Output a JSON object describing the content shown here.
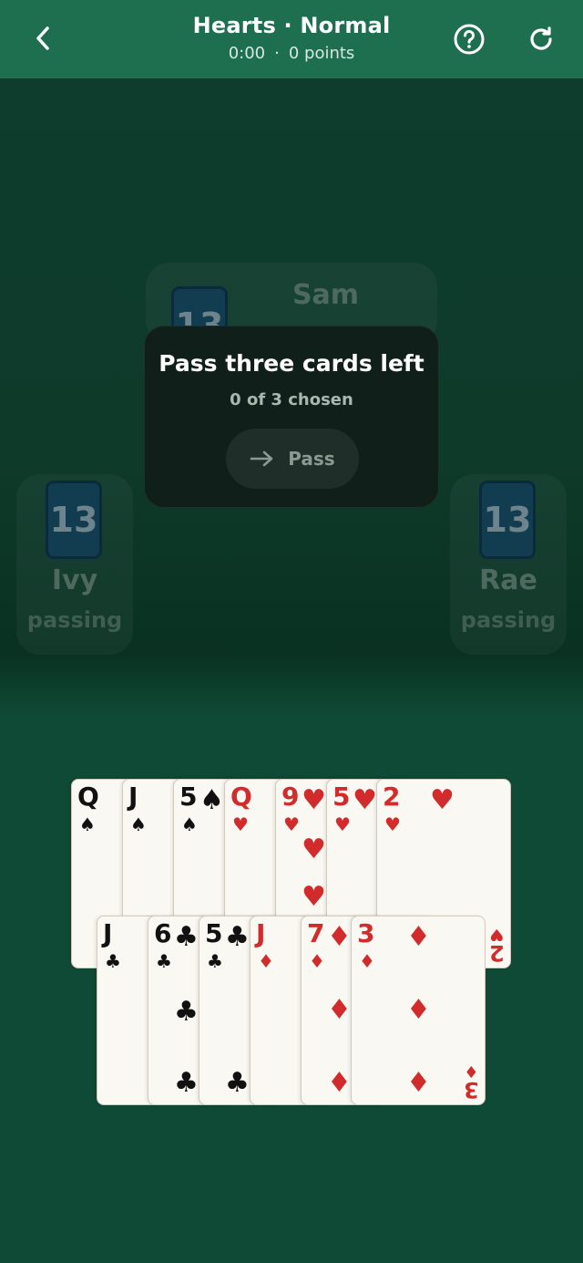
{
  "header": {
    "title": "Hearts · Normal",
    "timer": "0:00",
    "separator": "·",
    "points": "0 points"
  },
  "opponents": {
    "top": {
      "name": "Sam",
      "cards": "13"
    },
    "left": {
      "name": "Ivy",
      "cards": "13",
      "status": "passing"
    },
    "right": {
      "name": "Rae",
      "cards": "13",
      "status": "passing"
    }
  },
  "dialog": {
    "title": "Pass three cards left",
    "subtitle": "0 of 3 chosen",
    "pass_label": "Pass"
  },
  "hand": {
    "top_row": [
      {
        "rank": "Q",
        "suit": "♠",
        "color": "black"
      },
      {
        "rank": "J",
        "suit": "♠",
        "color": "black"
      },
      {
        "rank": "5",
        "suit": "♠",
        "color": "black"
      },
      {
        "rank": "Q",
        "suit": "♥",
        "color": "red"
      },
      {
        "rank": "9",
        "suit": "♥",
        "color": "red"
      },
      {
        "rank": "5",
        "suit": "♥",
        "color": "red"
      },
      {
        "rank": "2",
        "suit": "♥",
        "color": "red"
      }
    ],
    "bottom_row": [
      {
        "rank": "J",
        "suit": "♣",
        "color": "black"
      },
      {
        "rank": "6",
        "suit": "♣",
        "color": "black"
      },
      {
        "rank": "5",
        "suit": "♣",
        "color": "black"
      },
      {
        "rank": "J",
        "suit": "♦",
        "color": "red"
      },
      {
        "rank": "7",
        "suit": "♦",
        "color": "red"
      },
      {
        "rank": "3",
        "suit": "♦",
        "color": "red"
      }
    ]
  },
  "colors": {
    "header_bg": "#1e6e50",
    "table_bg": "#0f4a36",
    "red_suit": "#d22b2b",
    "black_suit": "#111111"
  },
  "icons": {
    "back": "chevron-left-icon",
    "help": "help-circle-icon",
    "reload": "reload-icon",
    "pass": "arrow-right-icon"
  }
}
